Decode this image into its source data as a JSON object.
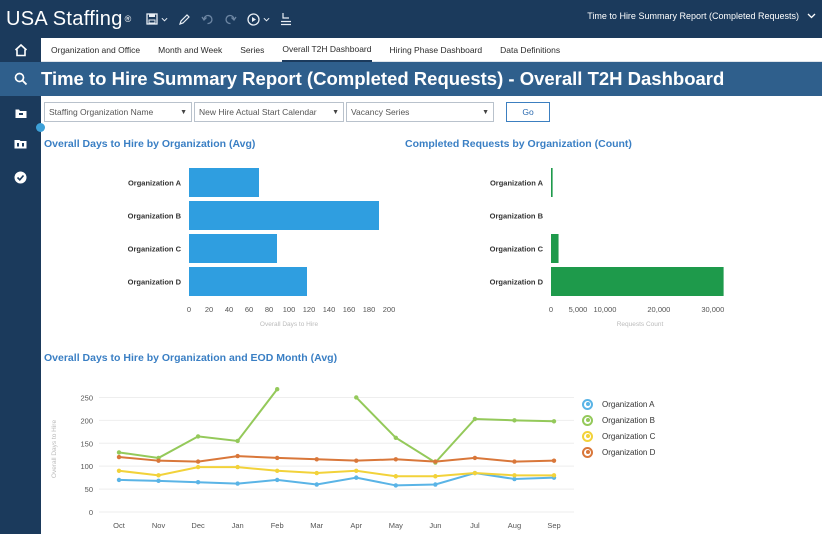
{
  "app": {
    "brand": "USA Staffing",
    "brand_mark": "®",
    "report_name": "Time to Hire Summary Report (Completed Requests)"
  },
  "tabs": [
    {
      "label": "Organization and Office"
    },
    {
      "label": "Month and Week"
    },
    {
      "label": "Series"
    },
    {
      "label": "Overall T2H Dashboard",
      "active": true
    },
    {
      "label": "Hiring Phase Dashboard"
    },
    {
      "label": "Data Definitions"
    }
  ],
  "page": {
    "title": "Time to Hire Summary Report (Completed Requests) - Overall T2H Dashboard"
  },
  "filters": [
    {
      "label": "Staffing Organization Name"
    },
    {
      "label": "New Hire Actual Start Calendar"
    },
    {
      "label": "Vacancy Series"
    }
  ],
  "go_label": "Go",
  "icons": {
    "home": "home-icon",
    "search": "search-icon",
    "rail": [
      "folder-icon",
      "library-icon",
      "check-circle-icon"
    ],
    "toolbar": [
      "save-icon",
      "pencil-icon",
      "undo-icon",
      "redo-icon",
      "play-icon",
      "export-icon"
    ]
  },
  "colors": {
    "topbar": "#1b3a5c",
    "titleband": "#2f5f8c",
    "bar_blue": "#2f9ee0",
    "bar_green": "#1e9a4b",
    "section_title": "#3a7fc4"
  },
  "chart_data": [
    {
      "id": "avg-days",
      "type": "bar",
      "orientation": "horizontal",
      "title": "Overall Days to Hire by Organization (Avg)",
      "xlabel": "Overall Days to Hire",
      "categories": [
        "Organization A",
        "Organization B",
        "Organization C",
        "Organization D"
      ],
      "values": [
        70,
        190,
        88,
        118
      ],
      "xlim": [
        0,
        200
      ],
      "ticks": [
        "0",
        "20",
        "40",
        "60",
        "80",
        "100",
        "120",
        "140",
        "160",
        "180",
        "200"
      ],
      "color": "#2f9ee0"
    },
    {
      "id": "count",
      "type": "bar",
      "orientation": "horizontal",
      "title": "Completed Requests by Organization (Count)",
      "xlabel": "Requests Count",
      "categories": [
        "Organization A",
        "Organization B",
        "Organization C",
        "Organization D"
      ],
      "values": [
        300,
        0,
        1400,
        32000
      ],
      "xlim": [
        0,
        33000
      ],
      "tick_values": [
        0,
        5000,
        10000,
        20000,
        30000
      ],
      "ticks": [
        "0",
        "5,000",
        "10,000",
        "20,000",
        "30,000"
      ],
      "color": "#1e9a4b"
    },
    {
      "id": "eod-month",
      "type": "line",
      "title": "Overall Days to Hire by Organization and EOD Month (Avg)",
      "ylabel": "Overall Days to Hire",
      "categories": [
        "Oct",
        "Nov",
        "Dec",
        "Jan",
        "Feb",
        "Mar",
        "Apr",
        "May",
        "Jun",
        "Jul",
        "Aug",
        "Sep"
      ],
      "ylim": [
        0,
        275
      ],
      "yticks": [
        0,
        50,
        100,
        150,
        200,
        250
      ],
      "legend_position": "right",
      "series": [
        {
          "name": "Organization A",
          "color": "#5ab4e6",
          "values": [
            70,
            68,
            65,
            62,
            70,
            60,
            75,
            58,
            60,
            85,
            72,
            75
          ]
        },
        {
          "name": "Organization B",
          "color": "#94c95a",
          "values": [
            130,
            118,
            165,
            155,
            268,
            null,
            250,
            162,
            108,
            203,
            200,
            198
          ]
        },
        {
          "name": "Organization C",
          "color": "#f2d23a",
          "values": [
            90,
            80,
            98,
            98,
            90,
            85,
            90,
            78,
            78,
            85,
            80,
            80
          ]
        },
        {
          "name": "Organization D",
          "color": "#d9773a",
          "values": [
            120,
            112,
            110,
            122,
            118,
            115,
            112,
            115,
            110,
            118,
            110,
            112
          ]
        }
      ]
    }
  ]
}
